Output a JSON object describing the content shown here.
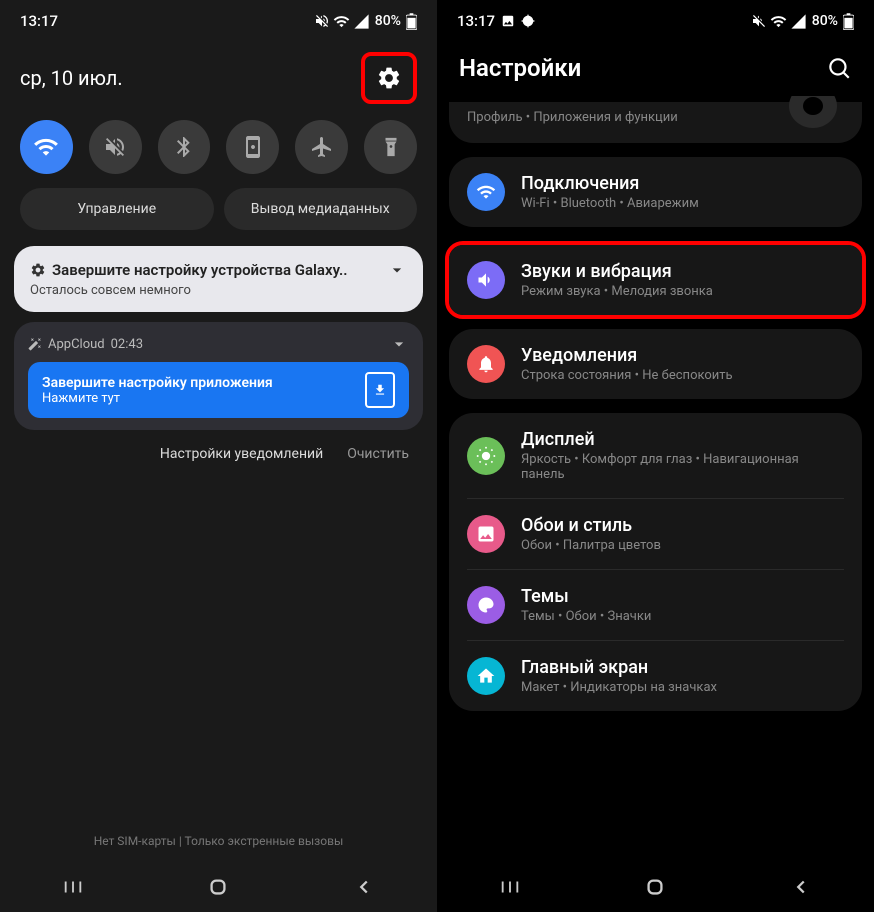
{
  "left": {
    "status": {
      "time": "13:17",
      "battery": "80%"
    },
    "date": "ср, 10 июл.",
    "pills": {
      "manage": "Управление",
      "media": "Вывод медиаданных"
    },
    "notif1": {
      "title": "Завершите настройку устройства Galaxy..",
      "sub": "Осталось совсем немного"
    },
    "notif2": {
      "source": "AppCloud",
      "time": "02:43",
      "title": "Завершите настройку приложения",
      "sub": "Нажмите тут"
    },
    "actions": {
      "settings": "Настройки уведомлений",
      "clear": "Очистить"
    },
    "footer": "Нет SIM-карты | Только экстренные вызовы"
  },
  "right": {
    "status": {
      "time": "13:17",
      "battery": "80%"
    },
    "title": "Настройки",
    "profile_sub": "Профиль  •  Приложения и функции",
    "items": {
      "connections": {
        "t": "Подключения",
        "s": "Wi-Fi  •  Bluetooth  •  Авиарежим"
      },
      "sounds": {
        "t": "Звуки и вибрация",
        "s": "Режим звука  •  Мелодия звонка"
      },
      "notifs": {
        "t": "Уведомления",
        "s": "Строка состояния  •  Не беспокоить"
      },
      "display": {
        "t": "Дисплей",
        "s": "Яркость  •  Комфорт для глаз  •  Навигационная панель"
      },
      "wallpaper": {
        "t": "Обои и стиль",
        "s": "Обои  •  Палитра цветов"
      },
      "themes": {
        "t": "Темы",
        "s": "Темы  •  Обои  •  Значки"
      },
      "home": {
        "t": "Главный экран",
        "s": "Макет  •  Индикаторы на значках"
      }
    }
  }
}
